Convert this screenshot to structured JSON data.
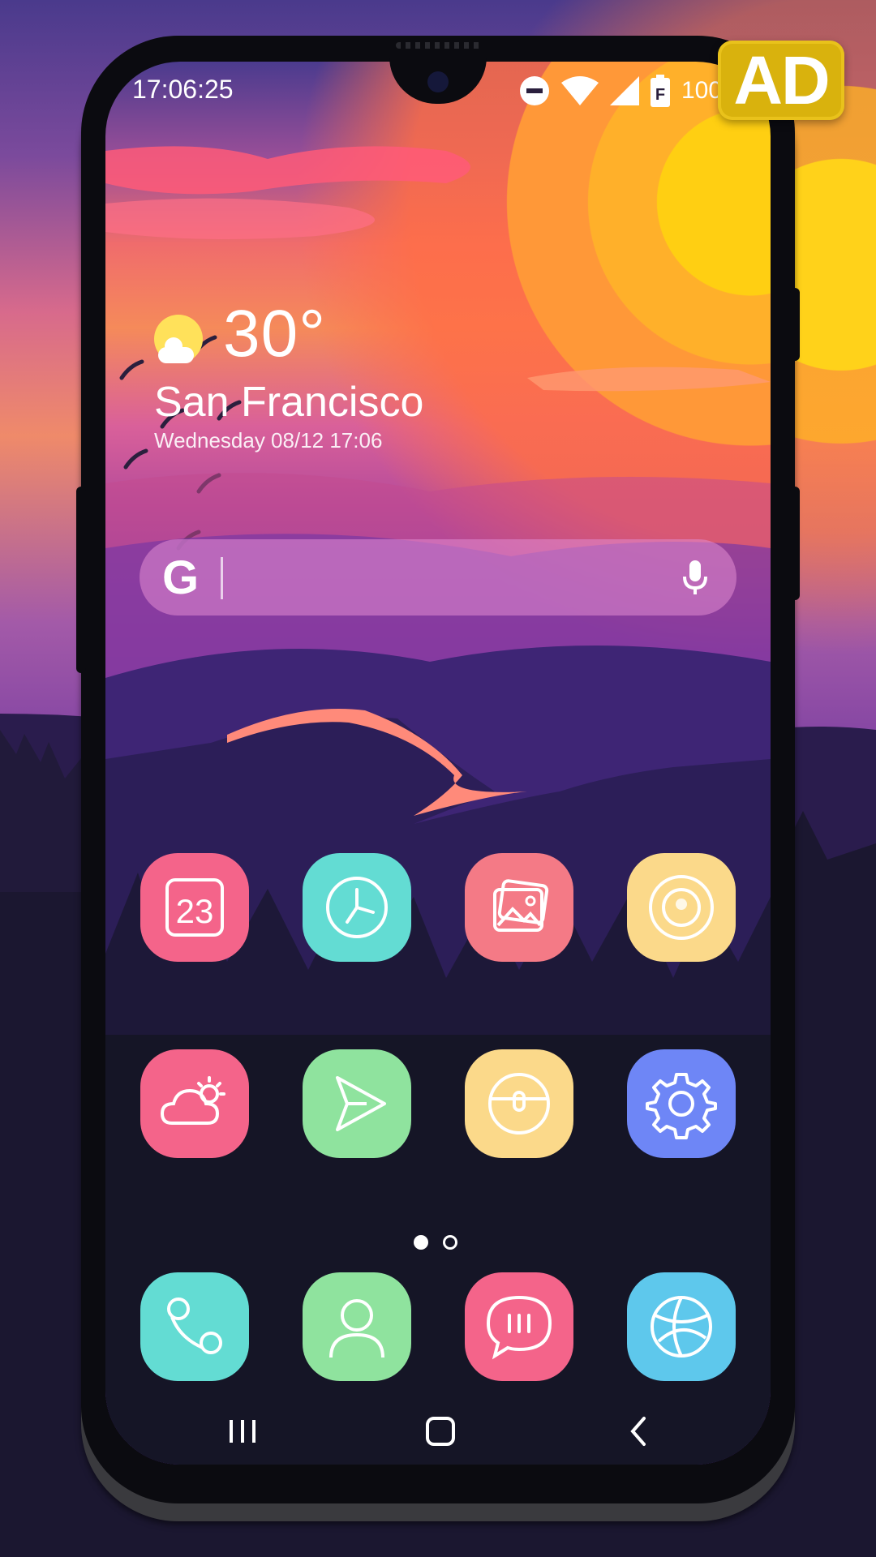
{
  "status_bar": {
    "time": "17:06:25",
    "battery_text": "100",
    "icons": [
      "do-not-disturb-icon",
      "wifi-icon",
      "signal-icon",
      "battery-icon"
    ]
  },
  "ad_badge": {
    "label": "AD",
    "color": "#d9b20d"
  },
  "weather": {
    "temperature": "30°",
    "city": "San Francisco",
    "datetime": "Wednesday 08/12 17:06",
    "icon": "sun-cloud-icon"
  },
  "search_bar": {
    "logo": "G",
    "icon": "microphone-icon"
  },
  "apps_row1": [
    {
      "name": "calendar",
      "icon": "calendar-icon",
      "color": "#f4648a",
      "date_text": "23"
    },
    {
      "name": "clock",
      "icon": "clock-icon",
      "color": "#63dcd3"
    },
    {
      "name": "gallery",
      "icon": "gallery-icon",
      "color": "#f47a86"
    },
    {
      "name": "camera",
      "icon": "camera-icon",
      "color": "#fbd98a"
    }
  ],
  "apps_row2": [
    {
      "name": "weather",
      "icon": "weather-icon",
      "color": "#f4648a"
    },
    {
      "name": "play-store",
      "icon": "play-icon",
      "color": "#8fe39e"
    },
    {
      "name": "file-manager",
      "icon": "folder-icon",
      "color": "#fbd98a"
    },
    {
      "name": "settings",
      "icon": "gear-icon",
      "color": "#6e86f6"
    }
  ],
  "page_indicator": {
    "current": 1,
    "total": 2
  },
  "dock": [
    {
      "name": "phone",
      "icon": "phone-icon",
      "color": "#63dcd3"
    },
    {
      "name": "contacts",
      "icon": "contacts-icon",
      "color": "#8fe39e"
    },
    {
      "name": "messages",
      "icon": "messages-icon",
      "color": "#f4648a"
    },
    {
      "name": "browser",
      "icon": "browser-icon",
      "color": "#5ec8ec"
    }
  ],
  "nav_bar": {
    "icons": [
      "recents-icon",
      "home-icon",
      "back-icon"
    ]
  }
}
